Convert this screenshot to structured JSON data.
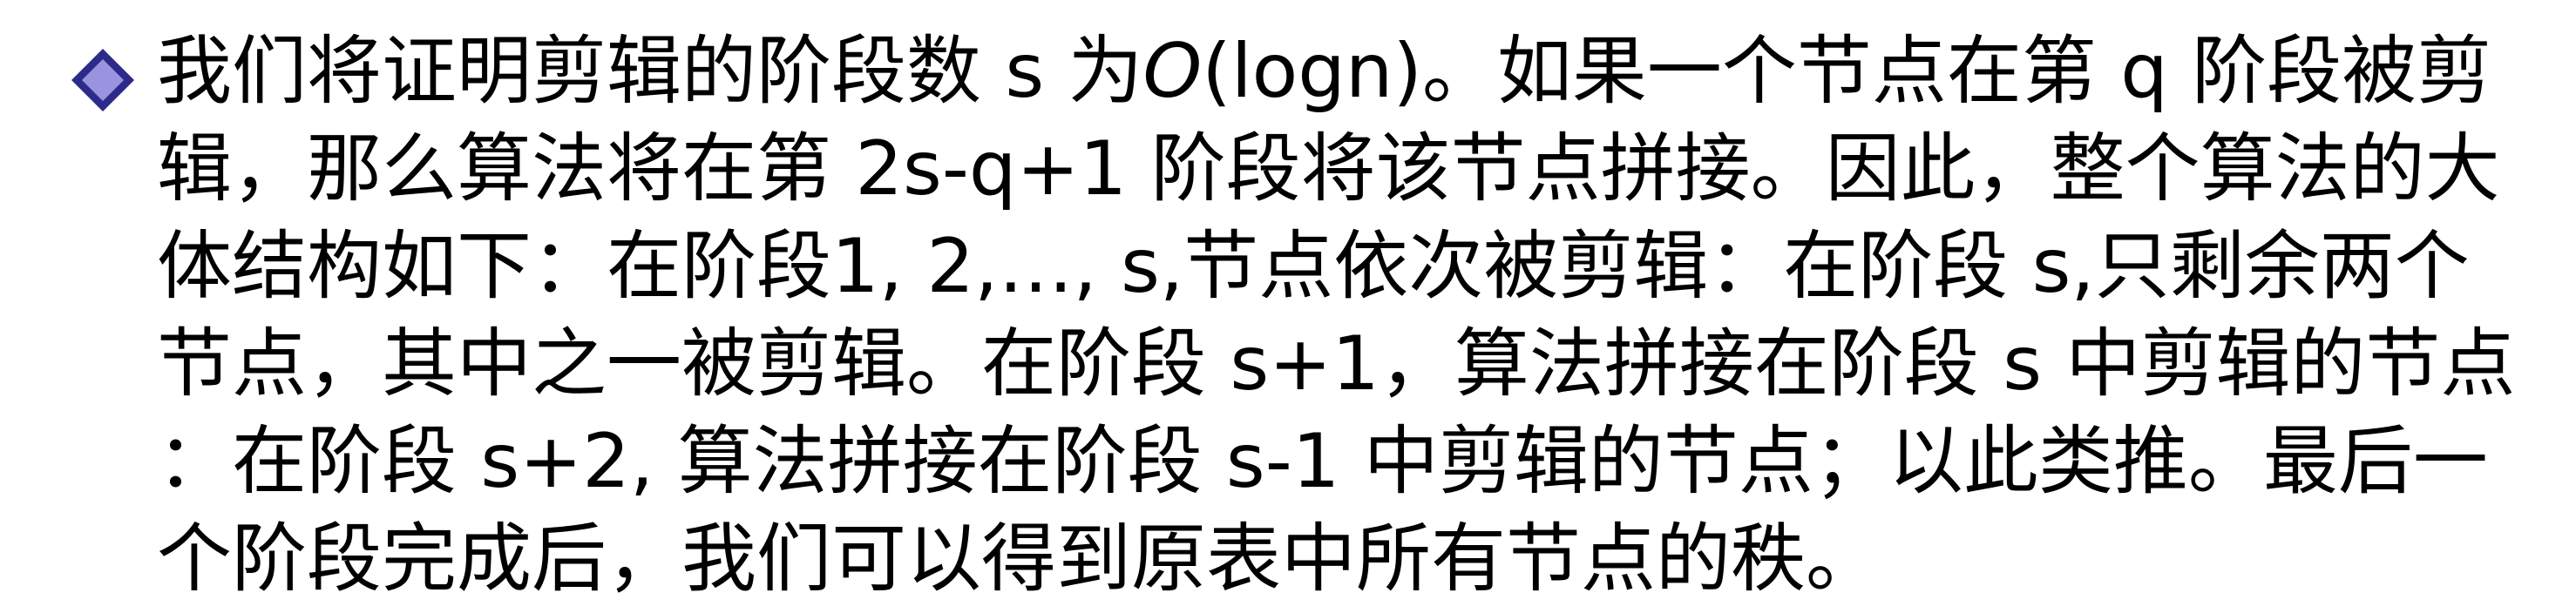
{
  "colors": {
    "bullet_outer": "#2e2a8a",
    "bullet_inner": "#9a93e0",
    "text": "#000000",
    "background": "#ffffff"
  },
  "bullet_icon": "diamond-bullet-icon",
  "paragraph": {
    "line1_a": "我们将证明剪辑的阶段数 s 为",
    "line1_math": "O",
    "line1_b": "(logn)。如果一个节点在第 q 阶段被剪",
    "line2": "辑，那么算法将在第 2s-q+1 阶段将该节点拼接。因此，整个算法的大",
    "line3": "体结构如下：在阶段1, 2,…, s,节点依次被剪辑：在阶段 s,只剩余两个",
    "line4": "节点，其中之一被剪辑。在阶段 s+1，算法拼接在阶段 s 中剪辑的节点",
    "line5": "：在阶段 s+2, 算法拼接在阶段 s-1 中剪辑的节点；以此类推。最后一",
    "line6": "个阶段完成后，我们可以得到原表中所有节点的秩。"
  }
}
